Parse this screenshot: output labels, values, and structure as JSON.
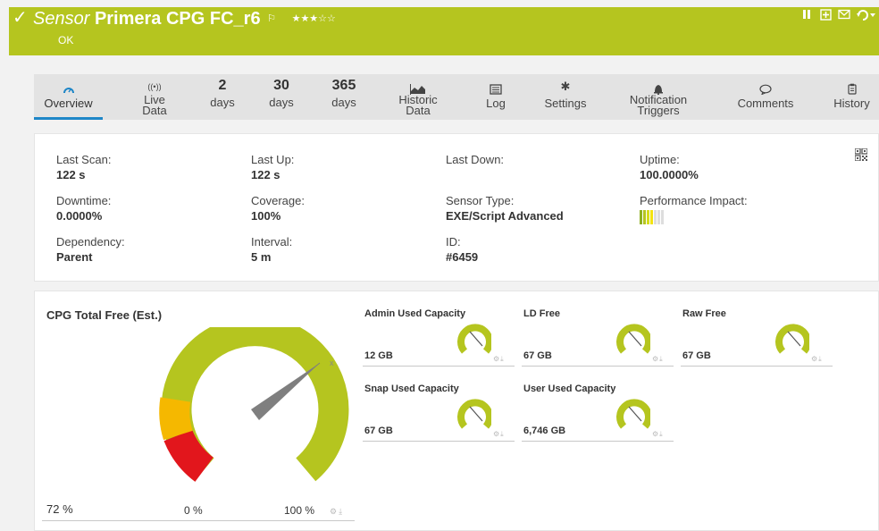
{
  "header": {
    "check_icon": "check-icon",
    "kind": "Sensor",
    "name": "Primera CPG FC_r6",
    "stars": "★★★☆☆",
    "status": "OK",
    "colors": {
      "bar": "#b5c51f"
    }
  },
  "tabs": [
    {
      "icon": "gauge-icon",
      "label": "Overview",
      "active": true
    },
    {
      "icon": "live-icon",
      "icon_text": "((•))",
      "label1": "Live",
      "label2": "Data"
    },
    {
      "num": "2",
      "label": "days"
    },
    {
      "num": "30",
      "label": "days"
    },
    {
      "num": "365",
      "label": "days"
    },
    {
      "icon": "area-chart-icon",
      "label1": "Historic",
      "label2": "Data"
    },
    {
      "icon": "log-icon",
      "label": "Log"
    },
    {
      "icon": "gear-icon",
      "label": "Settings"
    },
    {
      "icon": "bell-icon",
      "label1": "Notification",
      "label2": "Triggers"
    },
    {
      "icon": "comment-icon",
      "label": "Comments"
    },
    {
      "icon": "history-icon",
      "label": "History"
    }
  ],
  "info": {
    "last_scan": {
      "label": "Last Scan:",
      "value": "122 s"
    },
    "last_up": {
      "label": "Last Up:",
      "value": "122 s"
    },
    "last_down": {
      "label": "Last Down:",
      "value": ""
    },
    "uptime": {
      "label": "Uptime:",
      "value": "100.0000%"
    },
    "downtime": {
      "label": "Downtime:",
      "value": "0.0000%"
    },
    "coverage": {
      "label": "Coverage:",
      "value": "100%"
    },
    "sensor_type": {
      "label": "Sensor Type:",
      "value": "EXE/Script Advanced"
    },
    "performance_impact": {
      "label": "Performance Impact:"
    },
    "dependency": {
      "label": "Dependency:",
      "value": "Parent"
    },
    "interval": {
      "label": "Interval:",
      "value": "5 m"
    },
    "id": {
      "label": "ID:",
      "value": "#6459"
    }
  },
  "channels": {
    "primary": {
      "title": "CPG Total Free (Est.)",
      "value": "72 %",
      "min_label": "0 %",
      "max_label": "100 %",
      "fraction": 0.72
    },
    "minis": [
      {
        "title": "Admin Used Capacity",
        "value": "12 GB"
      },
      {
        "title": "LD Free",
        "value": "67 GB"
      },
      {
        "title": "Raw Free",
        "value": "67 GB"
      },
      {
        "title": "Snap Used Capacity",
        "value": "67 GB"
      },
      {
        "title": "User Used Capacity",
        "value": "6,746 GB"
      }
    ]
  }
}
